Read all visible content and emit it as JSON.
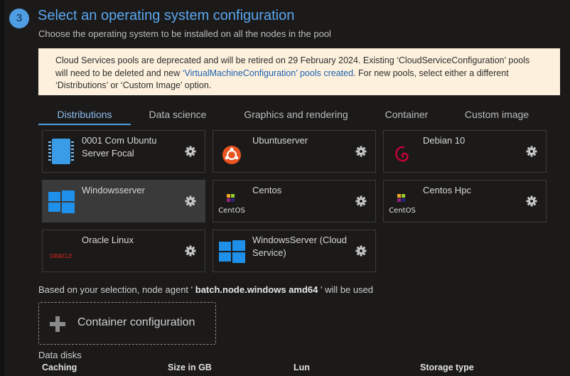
{
  "step": {
    "number": "3",
    "title": "Select an operating system configuration",
    "subtitle": "Choose the operating system to be installed on all the nodes in the pool"
  },
  "notice": {
    "text_before": "Cloud Services pools are deprecated and will be retired on 29 February 2024. Existing ‘CloudServiceConfiguration’ pools will need to be deleted and new ",
    "link": "‘VirtualMachineConfiguration’ pools created",
    "text_after": ". For new pools, select either a different ‘Distributions’ or ‘Custom Image’ option."
  },
  "tabs": [
    {
      "label": "Distributions",
      "active": true
    },
    {
      "label": "Data science",
      "active": false
    },
    {
      "label": "Graphics and rendering",
      "active": false
    },
    {
      "label": "Container",
      "active": false
    },
    {
      "label": "Custom image",
      "active": false
    }
  ],
  "os_options": [
    {
      "name": "0001 Com Ubuntu Server Focal",
      "icon": "vm-chip-icon"
    },
    {
      "name": "Ubuntuserver",
      "icon": "ubuntu-icon"
    },
    {
      "name": "Debian 10",
      "icon": "debian-icon"
    },
    {
      "name": "Windowsserver",
      "icon": "windows-icon",
      "selected": true
    },
    {
      "name": "Centos",
      "icon": "centos-icon",
      "logo_text": "CentOS"
    },
    {
      "name": "Centos Hpc",
      "icon": "centos-icon",
      "logo_text": "CentOS"
    },
    {
      "name": "Oracle Linux",
      "icon": "oracle-icon",
      "logo_text": "ORACLE"
    },
    {
      "name": "WindowsServer (Cloud Service)",
      "icon": "windows-icon"
    }
  ],
  "agent": {
    "prefix": "Based on your selection, node agent '",
    "value": " batch.node.windows amd64 ",
    "suffix": "' will be used"
  },
  "container_button": {
    "label": "Container configuration",
    "icon": "plus-icon"
  },
  "data_disks": {
    "label": "Data disks",
    "columns": [
      "Caching",
      "Size in GB",
      "Lun",
      "Storage type"
    ]
  },
  "colors": {
    "accent": "#4f9de3",
    "notice_bg": "#fdf1dd",
    "link": "#1d5fb0"
  }
}
